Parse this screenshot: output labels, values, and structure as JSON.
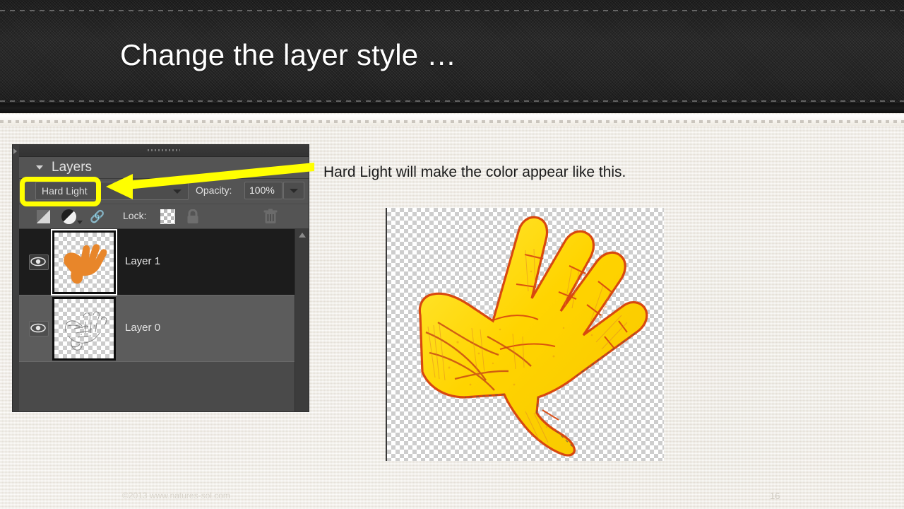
{
  "slide": {
    "title": "Change the layer style …",
    "caption": "Hard Light will make the color appear like this.",
    "footer_copyright": "©2013 www.natures-sol.com",
    "page_number": "16",
    "accent_color": "#ffff00",
    "banner_color": "#242424",
    "paper_color": "#f4f1eb"
  },
  "layers_panel": {
    "title": "Layers",
    "collapse_caret": "collapse-triangle-icon",
    "expand_chevrons": "»",
    "blend_mode": {
      "value": "Hard Light",
      "dropdown_icon": "chevron-down-icon"
    },
    "opacity": {
      "label": "Opacity:",
      "value": "100%",
      "dropdown_icon": "chevron-down-icon"
    },
    "lock": {
      "label": "Lock:",
      "icons": [
        "half-square-icon",
        "adjustment-circle-icon",
        "link-chain-icon",
        "transparency-checker-icon",
        "padlock-icon",
        "trash-icon"
      ]
    },
    "rows": [
      {
        "name": "Layer 1",
        "selected": true,
        "visible": true,
        "thumbnail": "orange-hand-thumbnail"
      },
      {
        "name": "Layer 0",
        "selected": false,
        "visible": true,
        "thumbnail": "sketch-hand-thumbnail"
      }
    ]
  },
  "result_image": {
    "alt": "yellow-hand-hard-light-result",
    "fill_color": "#ffdd00",
    "outline_color": "#d84e14",
    "background": "transparency-checkerboard"
  }
}
